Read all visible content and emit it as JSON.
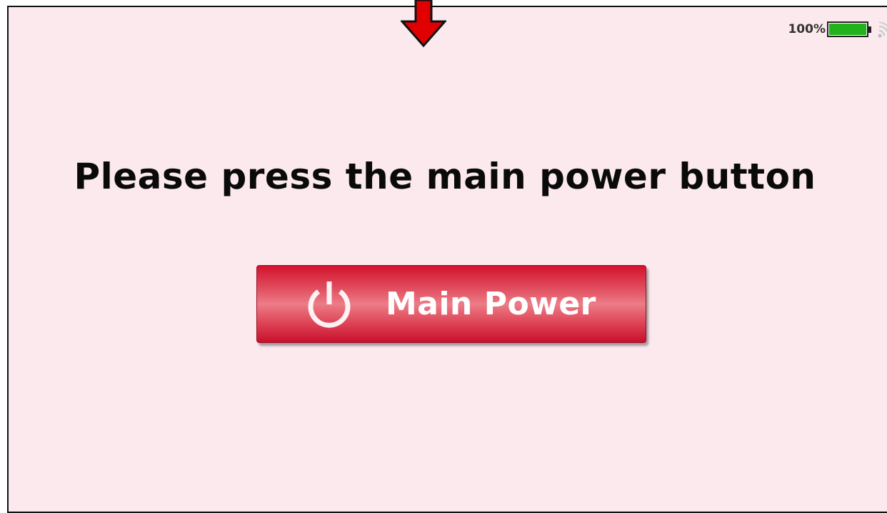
{
  "status_bar": {
    "battery_percent_label": "100%",
    "battery_level": 1.0,
    "battery_color": "#22b21c",
    "signal_icon": "wifi-signal-icon"
  },
  "pointer": {
    "icon": "down-arrow-icon",
    "color": "#e00000"
  },
  "prompt": {
    "text": "Please press the main power button"
  },
  "main_power_button": {
    "label": "Main Power",
    "icon": "power-icon",
    "color": "#d3122f"
  }
}
